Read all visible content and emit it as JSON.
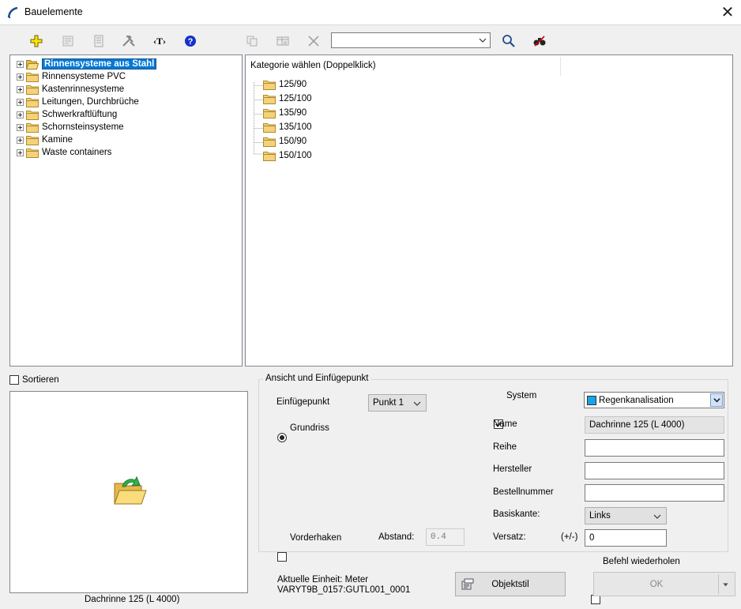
{
  "window": {
    "title": "Bauelemente"
  },
  "toolbar": {
    "icons": [
      "add-plus-icon",
      "properties-icon",
      "document-icon",
      "tools-icon",
      "text-tag-icon",
      "help-icon",
      "copy-icon",
      "table-icon",
      "delete-icon",
      "search-icon",
      "binoculars-icon"
    ],
    "text_tag_label": "‹T›",
    "search_value": ""
  },
  "tree": {
    "items": [
      {
        "label": "Rinnensysteme aus Stahl",
        "selected": true
      },
      {
        "label": "Rinnensysteme PVC"
      },
      {
        "label": "Kastenrinnesysteme"
      },
      {
        "label": "Leitungen, Durchbrüche"
      },
      {
        "label": "Schwerkraftlüftung"
      },
      {
        "label": "Schornsteinsysteme"
      },
      {
        "label": "Kamine"
      },
      {
        "label": "Waste containers"
      }
    ]
  },
  "category": {
    "header": "Kategorie wählen (Doppelklick)",
    "items": [
      "125/90",
      "125/100",
      "135/90",
      "135/100",
      "150/90",
      "150/100"
    ]
  },
  "sort": {
    "label": "Sortieren",
    "checked": false
  },
  "preview": {
    "caption": "Dachrinne 125 (L 4000)"
  },
  "group": {
    "title": "Ansicht und Einfügepunkt",
    "einfuegepunkt_label": "Einfügepunkt",
    "einfuegepunkt_value": "Punkt 1",
    "grundriss_label": "Grundriss",
    "vorderhaken_label": "Vorderhaken",
    "abstand_label": "Abstand:",
    "abstand_value": "0.4",
    "system_label": "System",
    "system_checked": true,
    "system_value": "Regenkanalisation",
    "system_color": "#1aa3e8",
    "name_label": "Name",
    "name_value": "Dachrinne 125 (L 4000)",
    "reihe_label": "Reihe",
    "reihe_value": "",
    "hersteller_label": "Hersteller",
    "hersteller_value": "",
    "bestellnummer_label": "Bestellnummer",
    "bestellnummer_value": "",
    "basiskante_label": "Basiskante:",
    "basiskante_value": "Links",
    "versatz_label": "Versatz:",
    "versatz_sign": "(+/-)",
    "versatz_value": "0"
  },
  "footer": {
    "repeat_label": "Befehl wiederholen",
    "unit_line": "Aktuelle Einheit: Meter",
    "id_line": "VARYT9B_0157:GUTL001_0001",
    "objektstil_label": "Objektstil",
    "ok_label": "OK"
  }
}
